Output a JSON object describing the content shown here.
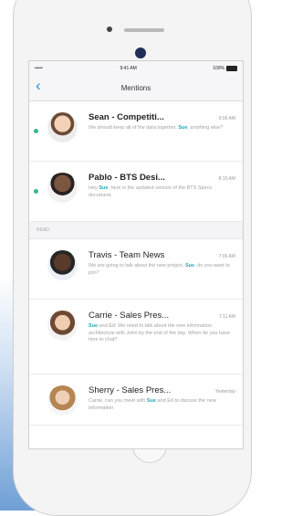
{
  "status_bar": {
    "carrier": "••••• ⁠",
    "time": "9:41 AM",
    "battery": "100%"
  },
  "nav": {
    "back_icon": "chevron-left-icon",
    "title": "Mentions"
  },
  "section_label": "READ",
  "unread": [
    {
      "sender": "Sean - Competiti...",
      "time": "9:06 AM",
      "pre": "We should keep all of the data together. ",
      "mention": "Sue",
      "post": ", anything else?"
    },
    {
      "sender": "Pablo - BTS Desi...",
      "time": "8:10 AM",
      "pre": "Hey ",
      "mention": "Sue",
      "post": ", here is the updated version of the BTS Specs document."
    }
  ],
  "read": [
    {
      "sender": "Travis - Team News",
      "time": "7:06 AM",
      "pre": "We are going to talk about the new project. ",
      "mention": "Sue",
      "post": ", do you want to join?"
    },
    {
      "sender": "Carrie - Sales Pres...",
      "time": "7:11 AM",
      "pre": "",
      "mention": "Sue",
      "post": " and Ed: We need to talk about the new information architecture with John by the end of the day. When do you have time to chat?"
    },
    {
      "sender": "Sherry - Sales Pres...",
      "time": "Yesterday",
      "pre": "Carrie, can you meet with ",
      "mention": "Sue",
      "post": " and Ed to discuss the new information"
    }
  ]
}
